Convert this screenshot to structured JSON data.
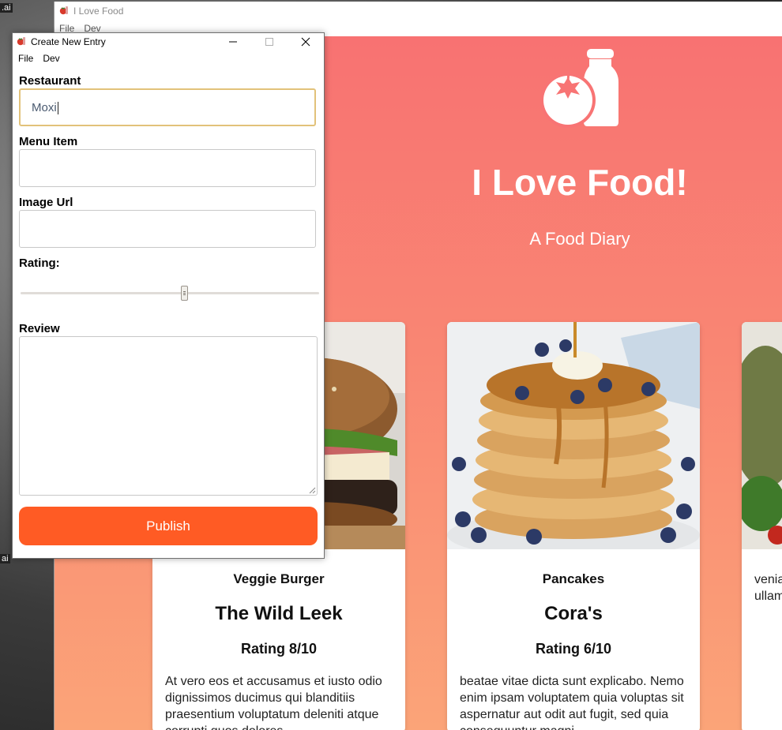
{
  "desktop": {
    "label_top": ".ai",
    "label_bottom": "ai"
  },
  "main_window": {
    "title": "I Love Food",
    "menu": [
      "File",
      "Dev"
    ]
  },
  "hero": {
    "title": "I Love Food!",
    "subtitle": "A Food Diary",
    "logo_icon": "tomato-and-bottle-icon"
  },
  "cards": [
    {
      "menu_item": "Veggie Burger",
      "restaurant": "The Wild Leek",
      "rating": "Rating 8/10",
      "review": "At vero eos et accusamus et iusto odio dignissimos ducimus qui blanditiis praesentium voluptatum deleniti atque corrupti quos dolores",
      "image": "burger-photo"
    },
    {
      "menu_item": "Pancakes",
      "restaurant": "Cora's",
      "rating": "Rating 6/10",
      "review": "beatae vitae dicta sunt explicabo. Nemo enim ipsam voluptatem quia voluptas sit aspernatur aut odit aut fugit, sed quia consequuntur magni",
      "image": "pancakes-photo"
    },
    {
      "menu_item": "",
      "restaurant": "",
      "rating": "",
      "review": "veniam, quis nostrud exercitation ullamco laboris nisi ut aliquip ex ea",
      "image": "salad-photo"
    }
  ],
  "dialog": {
    "title": "Create New Entry",
    "menu": [
      "File",
      "Dev"
    ],
    "window_buttons": {
      "minimize": "—",
      "maximize": "☐",
      "close": "✕"
    },
    "fields": {
      "restaurant": {
        "label": "Restaurant",
        "value": "Moxi"
      },
      "menu_item": {
        "label": "Menu Item",
        "value": ""
      },
      "image_url": {
        "label": "Image Url",
        "value": ""
      },
      "rating": {
        "label": "Rating:",
        "value_fraction": 0.55
      },
      "review": {
        "label": "Review",
        "value": ""
      }
    },
    "publish_label": "Publish"
  },
  "colors": {
    "hero_top": "#f87272",
    "hero_bottom": "#fba478",
    "publish": "#ff5b24",
    "focus_border": "#e2c27a"
  }
}
